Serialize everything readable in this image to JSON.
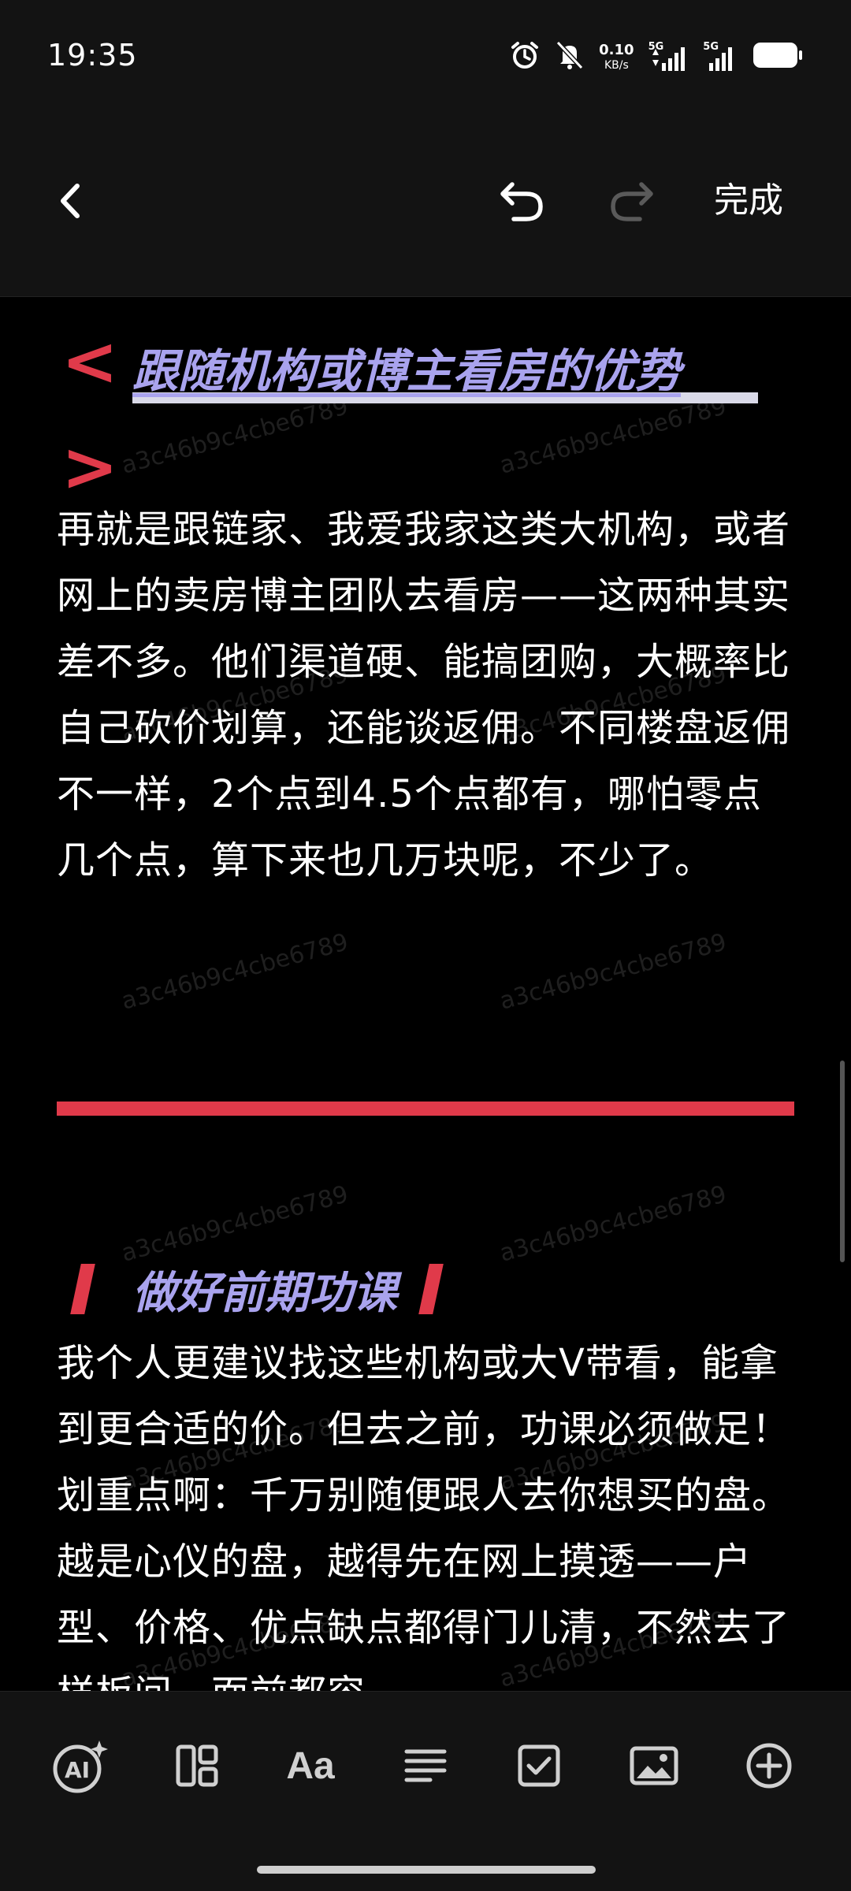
{
  "status_bar": {
    "time": "19:35",
    "net_speed_value": "0.10",
    "net_speed_unit": "KB/s",
    "signal1_label": "5G",
    "signal2_label": "5G",
    "icons": [
      "alarm-icon",
      "mute-icon",
      "signal-icon",
      "signal-icon",
      "battery-icon"
    ]
  },
  "toolbar": {
    "back_icon": "chevron-left-icon",
    "undo_icon": "undo-icon",
    "redo_icon": "redo-icon",
    "done_label": "完成"
  },
  "document": {
    "heading1_open": "<",
    "heading1_close": ">",
    "heading1": "跟随机构或博主看房的优势",
    "paragraph1": "再就是跟链家、我爱我家这类大机构，或者网上的卖房博主团队去看房——这两种其实差不多。他们渠道硬、能搞团购，大概率比自己砍价划算，还能谈返佣。不同楼盘返佣不一样，2个点到4.5个点都有，哪怕零点几个点，算下来也几万块呢，不少了。",
    "heading2": "做好前期功课",
    "paragraph2": "我个人更建议找这些机构或大V带看，能拿到更合适的价。但去之前，功课必须做足！划重点啊：千万别随便跟人去你想买的盘。越是心仪的盘，越得先在网上摸透——户型、价格、优点缺点都得门儿清，不然去了样板间，面前都容",
    "watermark": "a3c46b9c4cbe6789"
  },
  "format_bar": {
    "items": [
      "ai-assist-icon",
      "layout-icon",
      "text-format-icon",
      "align-icon",
      "checkbox-icon",
      "image-icon",
      "add-icon"
    ],
    "ai_label": "AI",
    "font_label": "Aa"
  },
  "colors": {
    "accent_red": "#e03a4a",
    "heading_purple": "#a9a3ee",
    "background": "#000000",
    "bar_background": "#131313"
  }
}
